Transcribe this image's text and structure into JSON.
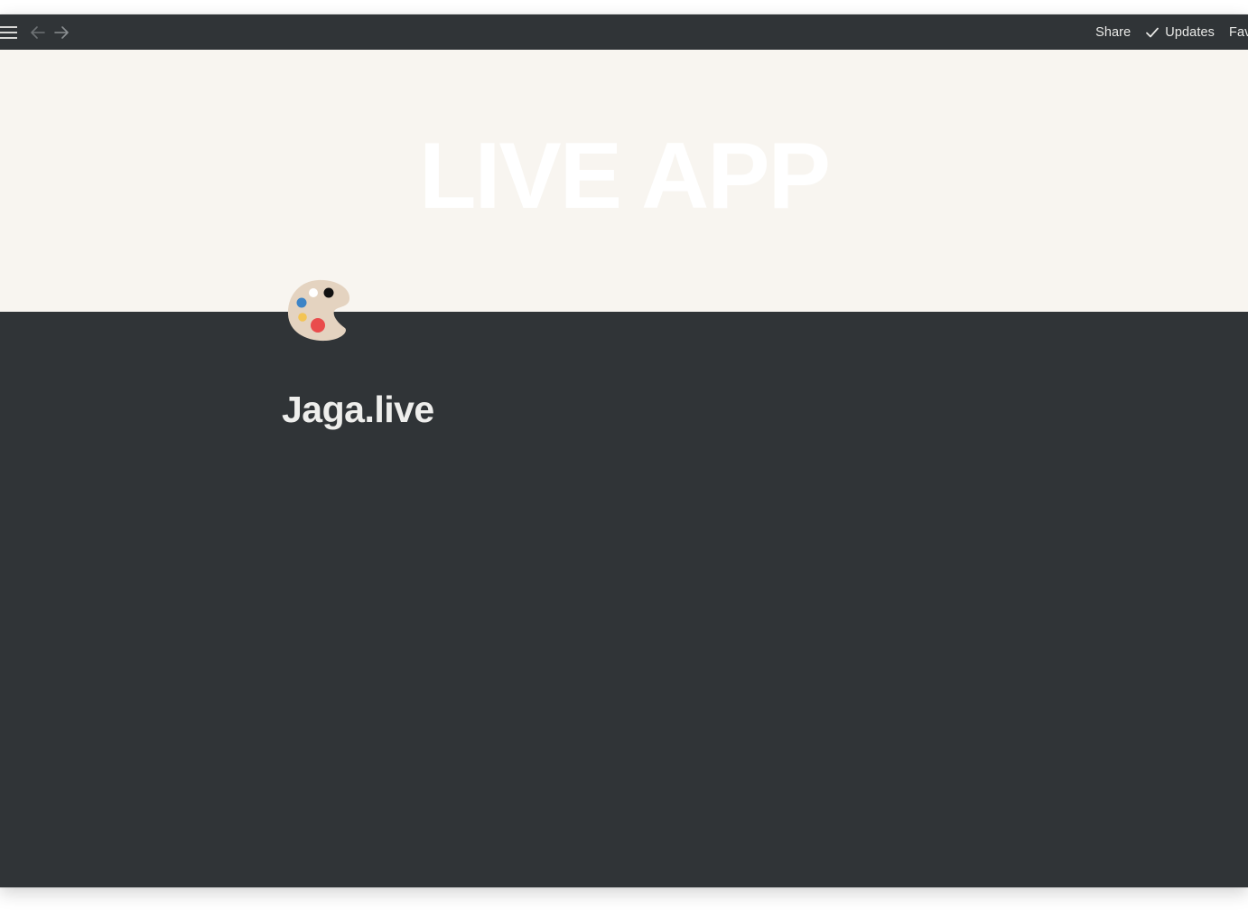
{
  "topbar": {
    "share_label": "Share",
    "updates_label": "Updates",
    "favorite_label": "Favorite"
  },
  "cover": {
    "text": "LIVE APP"
  },
  "page": {
    "icon": "artist-palette-icon",
    "title": "Jaga.live"
  },
  "colors": {
    "dark_bg": "#303437",
    "cover_bg": "#f8f5f0",
    "text_light": "#e9e9e7"
  }
}
